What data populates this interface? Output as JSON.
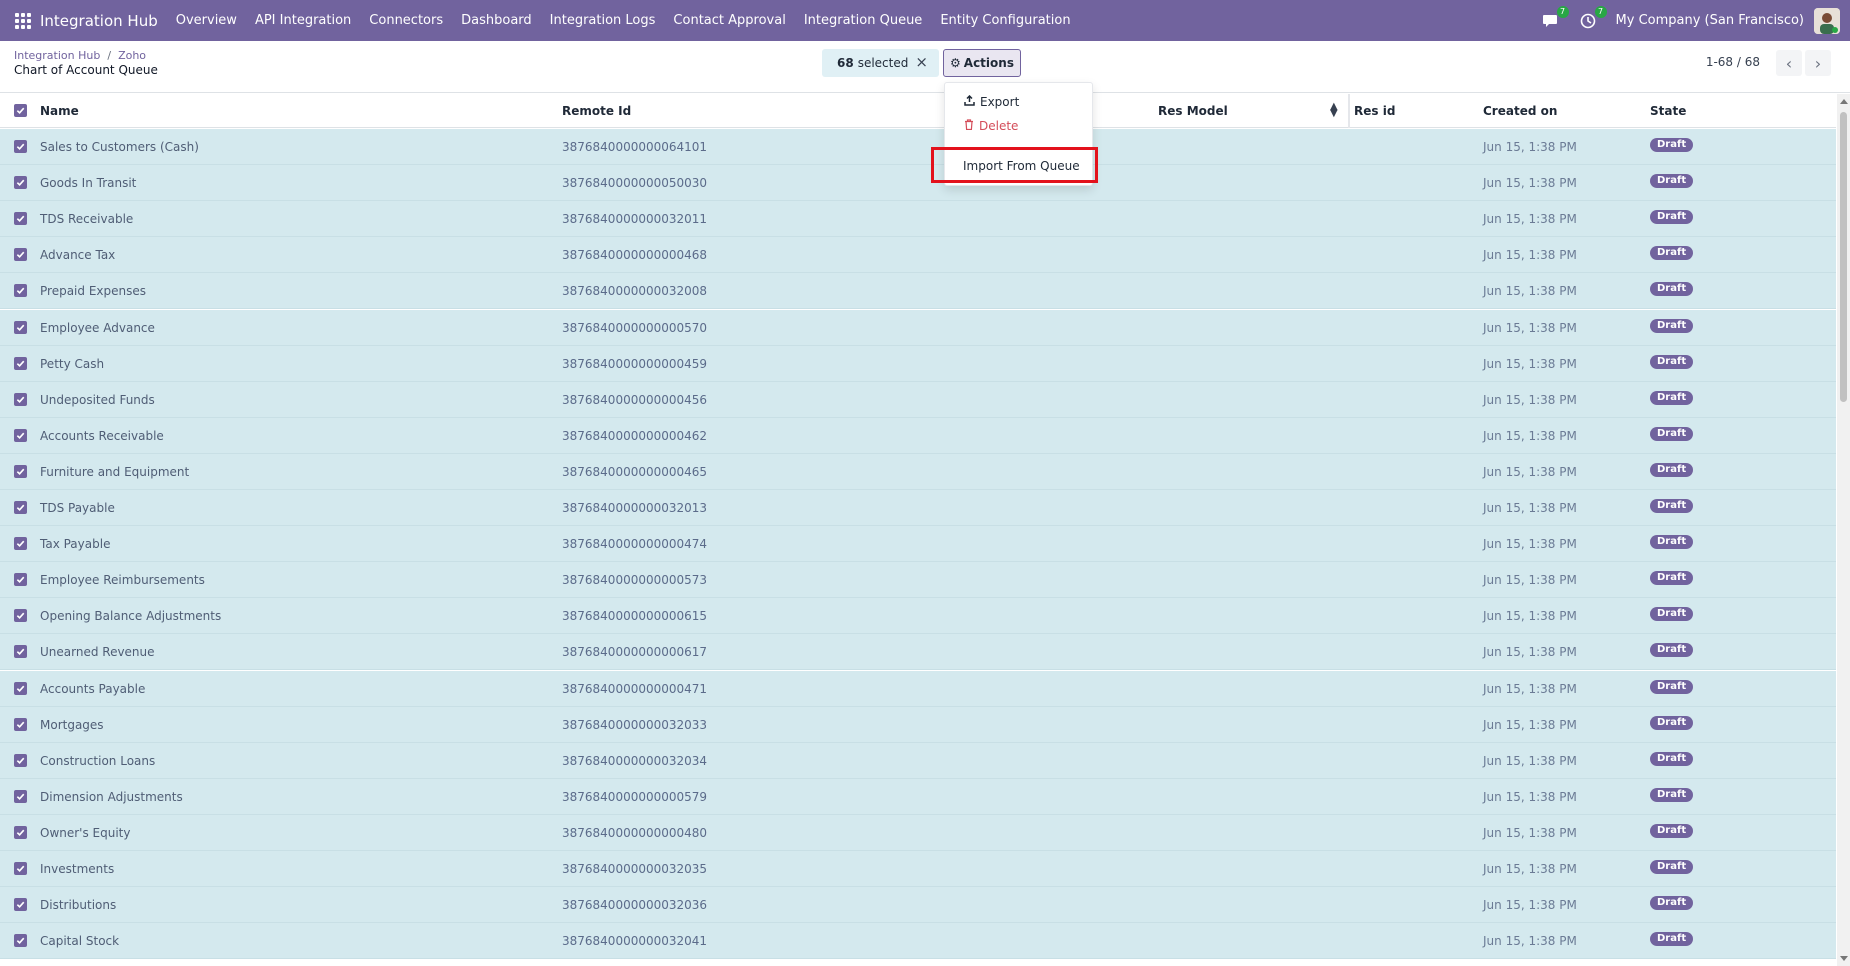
{
  "navbar": {
    "brand": "Integration Hub",
    "menu": [
      "Overview",
      "API Integration",
      "Connectors",
      "Dashboard",
      "Integration Logs",
      "Contact Approval",
      "Integration Queue",
      "Entity Configuration"
    ],
    "messages_count": "7",
    "activities_count": "7",
    "company": "My Company (San Francisco)",
    "icons": {
      "apps": "apps-grid-icon",
      "messages": "chat-icon",
      "activities": "clock-icon",
      "avatar": "user-avatar"
    },
    "bg_color": "#71639e"
  },
  "breadcrumb": {
    "parent": "Integration Hub",
    "child": "Zoho",
    "separator": "/"
  },
  "page_title": "Chart of Account Queue",
  "selection": {
    "count": "68",
    "label": "selected",
    "clear_icon": "×"
  },
  "actions": {
    "label": "Actions",
    "icon": "gear-icon",
    "menu": {
      "export": "Export",
      "delete": "Delete",
      "import": "Import From Queue"
    }
  },
  "pager": {
    "text": "1-68 / 68"
  },
  "columns": [
    "Name",
    "Remote Id",
    "Res Model",
    "Res id",
    "Created on",
    "State"
  ],
  "rows": [
    {
      "name": "Sales to Customers (Cash)",
      "remote_id": "3876840000000064101",
      "created_on": "Jun 15, 1:38 PM",
      "state": "Draft"
    },
    {
      "name": "Goods In Transit",
      "remote_id": "3876840000000050030",
      "created_on": "Jun 15, 1:38 PM",
      "state": "Draft"
    },
    {
      "name": "TDS Receivable",
      "remote_id": "3876840000000032011",
      "created_on": "Jun 15, 1:38 PM",
      "state": "Draft"
    },
    {
      "name": "Advance Tax",
      "remote_id": "3876840000000000468",
      "created_on": "Jun 15, 1:38 PM",
      "state": "Draft"
    },
    {
      "name": "Prepaid Expenses",
      "remote_id": "3876840000000032008",
      "created_on": "Jun 15, 1:38 PM",
      "state": "Draft"
    },
    {
      "name": "Employee Advance",
      "remote_id": "3876840000000000570",
      "created_on": "Jun 15, 1:38 PM",
      "state": "Draft"
    },
    {
      "name": "Petty Cash",
      "remote_id": "3876840000000000459",
      "created_on": "Jun 15, 1:38 PM",
      "state": "Draft"
    },
    {
      "name": "Undeposited Funds",
      "remote_id": "3876840000000000456",
      "created_on": "Jun 15, 1:38 PM",
      "state": "Draft"
    },
    {
      "name": "Accounts Receivable",
      "remote_id": "3876840000000000462",
      "created_on": "Jun 15, 1:38 PM",
      "state": "Draft"
    },
    {
      "name": "Furniture and Equipment",
      "remote_id": "3876840000000000465",
      "created_on": "Jun 15, 1:38 PM",
      "state": "Draft"
    },
    {
      "name": "TDS Payable",
      "remote_id": "3876840000000032013",
      "created_on": "Jun 15, 1:38 PM",
      "state": "Draft"
    },
    {
      "name": "Tax Payable",
      "remote_id": "3876840000000000474",
      "created_on": "Jun 15, 1:38 PM",
      "state": "Draft"
    },
    {
      "name": "Employee Reimbursements",
      "remote_id": "3876840000000000573",
      "created_on": "Jun 15, 1:38 PM",
      "state": "Draft"
    },
    {
      "name": "Opening Balance Adjustments",
      "remote_id": "3876840000000000615",
      "created_on": "Jun 15, 1:38 PM",
      "state": "Draft"
    },
    {
      "name": "Unearned Revenue",
      "remote_id": "3876840000000000617",
      "created_on": "Jun 15, 1:38 PM",
      "state": "Draft"
    },
    {
      "name": "Accounts Payable",
      "remote_id": "3876840000000000471",
      "created_on": "Jun 15, 1:38 PM",
      "state": "Draft"
    },
    {
      "name": "Mortgages",
      "remote_id": "3876840000000032033",
      "created_on": "Jun 15, 1:38 PM",
      "state": "Draft"
    },
    {
      "name": "Construction Loans",
      "remote_id": "3876840000000032034",
      "created_on": "Jun 15, 1:38 PM",
      "state": "Draft"
    },
    {
      "name": "Dimension Adjustments",
      "remote_id": "3876840000000000579",
      "created_on": "Jun 15, 1:38 PM",
      "state": "Draft"
    },
    {
      "name": "Owner's Equity",
      "remote_id": "3876840000000000480",
      "created_on": "Jun 15, 1:38 PM",
      "state": "Draft"
    },
    {
      "name": "Investments",
      "remote_id": "3876840000000032035",
      "created_on": "Jun 15, 1:38 PM",
      "state": "Draft"
    },
    {
      "name": "Distributions",
      "remote_id": "3876840000000032036",
      "created_on": "Jun 15, 1:38 PM",
      "state": "Draft"
    },
    {
      "name": "Capital Stock",
      "remote_id": "3876840000000032041",
      "created_on": "Jun 15, 1:38 PM",
      "state": "Draft"
    }
  ],
  "colors": {
    "accent": "#71639e",
    "selected_row": "#d4e9ee",
    "danger": "#d44c59",
    "highlight": "#e3121c"
  }
}
